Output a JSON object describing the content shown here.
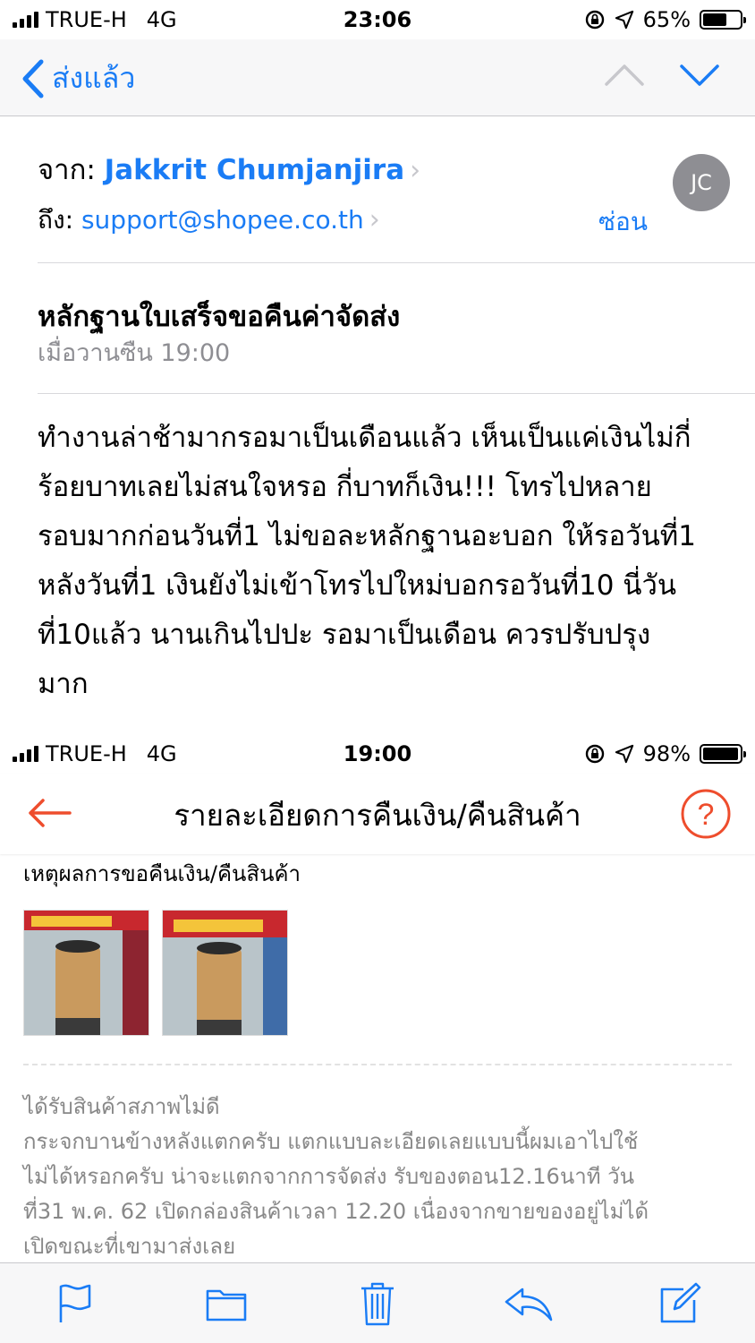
{
  "status_top": {
    "carrier": "TRUE-H",
    "network": "4G",
    "time": "23:06",
    "battery": "65%",
    "battery_level": 0.65
  },
  "nav": {
    "back_label": "ส่งแล้ว"
  },
  "header": {
    "from_label": "จาก:",
    "from_name": "Jakkrit Chumjanjira",
    "to_label": "ถึง:",
    "to_address": "support@shopee.co.th",
    "hide_label": "ซ่อน",
    "avatar_initials": "JC"
  },
  "message": {
    "subject": "หลักฐานใบเสร็จขอคืนค่าจัดส่ง",
    "date": "เมื่อวานซืน 19:00",
    "body_lines": [
      "ทำงานล่าช้ามากรอมาเป็นเดือนแล้ว เห็นเป็นแค่เงินไม่กี่",
      "ร้อยบาทเลยไม่สนใจหรอ กี่บาทก็เงิน!!! โทรไปหลาย",
      "รอบมากก่อนวันที่1 ไม่ขอละหลักฐานอะบอก ให้รอวันที่1",
      "หลังวันที่1 เงินยังไม่เข้าโทรไปใหม่บอกรอวันที่10 นี่วัน",
      "ที่10แล้ว นานเกินไปปะ รอมาเป็นเดือน ควรปรับปรุง",
      "มาก"
    ]
  },
  "screenshot": {
    "status": {
      "carrier": "TRUE-H",
      "network": "4G",
      "time": "19:00",
      "battery": "98%",
      "battery_level": 0.98
    },
    "title": "รายละเอียดการคืนเงิน/คืนสินค้า",
    "reason_header": "เหตุผลการขอคืนเงิน/คืนสินค้า",
    "reason_title": "ได้รับสินค้าสภาพไม่ดี",
    "reason_lines": [
      "กระจกบานข้างหลังแตกครับ แตกแบบละเอียดเลยแบบนี้ผมเอาไปใช้",
      "ไม่ได้หรอกครับ น่าจะแตกจากการจัดส่ง รับของตอน12.16นาที วัน",
      "ที่31 พ.ค. 62 เปิดกล่องสินค้าเวลา 12.20 เนื่องจากขายของอยู่ไม่ได้",
      "เปิดขณะที่เขามาส่งเลย"
    ],
    "accent": "#ee4d2d"
  },
  "colors": {
    "ios_blue": "#1a7cf5",
    "gray_text": "#8e8e93"
  },
  "toolbar_icons": [
    "flag-icon",
    "folder-icon",
    "trash-icon",
    "reply-icon",
    "compose-icon"
  ]
}
